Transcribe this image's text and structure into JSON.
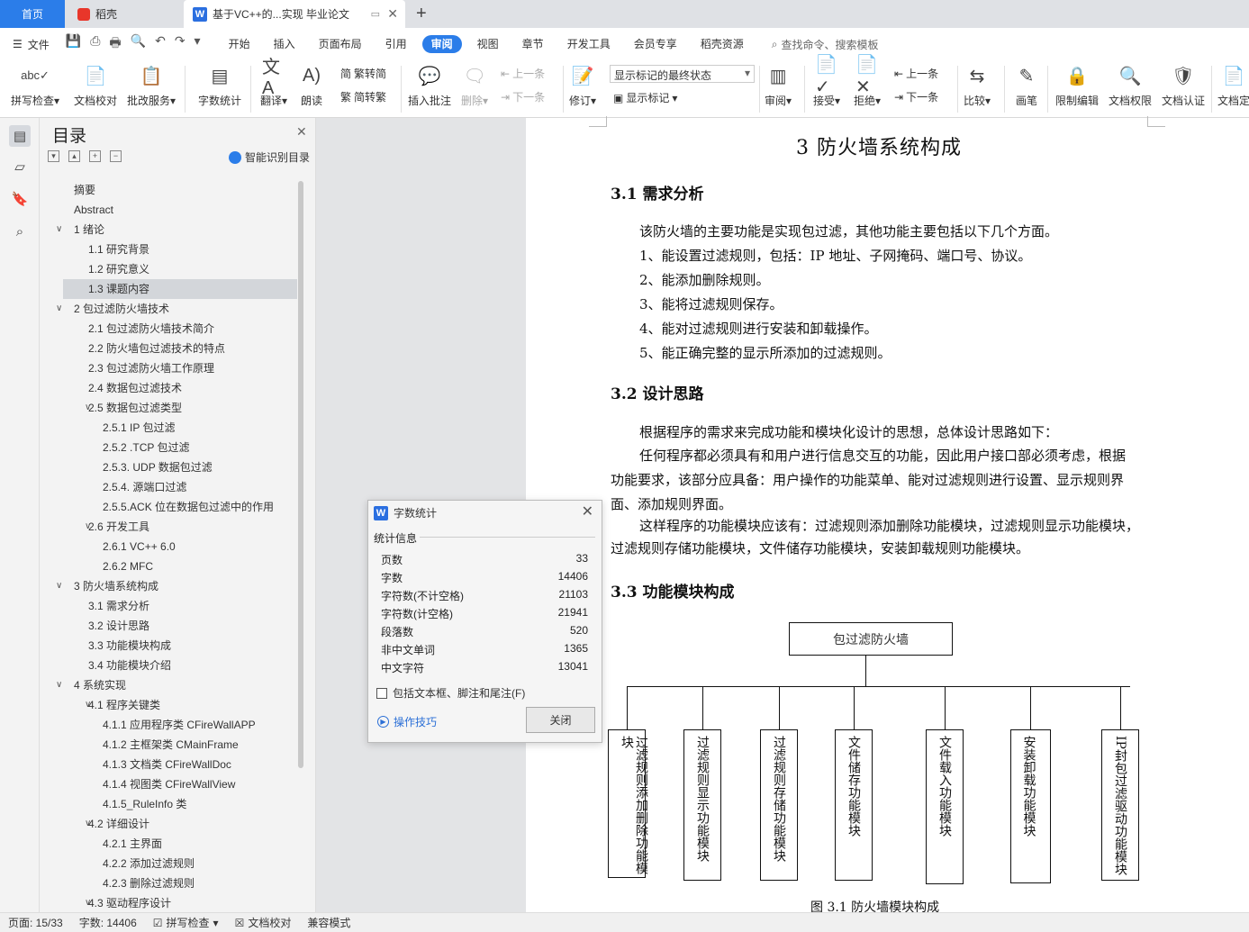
{
  "tabs": {
    "home": "首页",
    "doc": "稻壳",
    "active": "基于VC++的...实现 毕业论文"
  },
  "menu": {
    "file": "文件",
    "tabs": [
      "开始",
      "插入",
      "页面布局",
      "引用",
      "审阅",
      "视图",
      "章节",
      "开发工具",
      "会员专享",
      "稻壳资源"
    ],
    "active_tab": "审阅",
    "search": "查找命令、搜索模板"
  },
  "ribbon": {
    "spell": "拼写检查",
    "proof": "文档校对",
    "annotate_service": "批改服务",
    "wordcount": "字数统计",
    "translate": "翻译",
    "read": "朗读",
    "to_trad": "繁转简",
    "to_simp": "简转繁",
    "insert_comment": "插入批注",
    "delete": "删除",
    "prev": "上一条",
    "next": "下一条",
    "revise": "修订",
    "mark_state": "显示标记的最终状态",
    "show_mark": "显示标记",
    "review": "审阅",
    "accept": "接受",
    "reject": "拒绝",
    "prev2": "上一条",
    "next2": "下一条",
    "compare": "比较",
    "pen": "画笔",
    "restrict": "限制编辑",
    "rights": "文档权限",
    "auth": "文档认证",
    "finalize": "文档定"
  },
  "nav": {
    "title": "目录",
    "smart": "智能识别目录",
    "items": [
      {
        "text": "摘要",
        "level": 0
      },
      {
        "text": "Abstract",
        "level": 0
      },
      {
        "text": "1  绪论",
        "level": 1
      },
      {
        "text": "1.1  研究背景",
        "level": 2
      },
      {
        "text": "1.2  研究意义",
        "level": 2
      },
      {
        "text": "1.3  课题内容",
        "level": 2
      },
      {
        "text": "2  包过滤防火墙技术",
        "level": 1
      },
      {
        "text": "2.1  包过滤防火墙技术简介",
        "level": 2
      },
      {
        "text": "2.2  防火墙包过滤技术的特点",
        "level": 2
      },
      {
        "text": "2.3  包过滤防火墙工作原理",
        "level": 2
      },
      {
        "text": "2.4  数据包过滤技术",
        "level": 2
      },
      {
        "text": "2.5  数据包过滤类型",
        "level": 3
      },
      {
        "text": "2.5.1 IP 包过滤",
        "level": 4
      },
      {
        "text": "2.5.2 .TCP 包过滤",
        "level": 4
      },
      {
        "text": "2.5.3. UDP 数据包过滤",
        "level": 4
      },
      {
        "text": "2.5.4.  源端口过滤",
        "level": 4
      },
      {
        "text": "2.5.5.ACK 位在数据包过滤中的作用",
        "level": 4
      },
      {
        "text": "2.6 开发工具",
        "level": 3
      },
      {
        "text": "2.6.1 VC++ 6.0",
        "level": 4
      },
      {
        "text": "2.6.2 MFC",
        "level": 4
      },
      {
        "text": "3  防火墙系统构成",
        "level": 1
      },
      {
        "text": "3.1  需求分析",
        "level": 2
      },
      {
        "text": "3.2  设计思路",
        "level": 2
      },
      {
        "text": "3.3  功能模块构成",
        "level": 2
      },
      {
        "text": "3.4  功能模块介绍",
        "level": 2
      },
      {
        "text": "4  系统实现",
        "level": 1
      },
      {
        "text": "4.1 程序关键类",
        "level": 3
      },
      {
        "text": "4.1.1 应用程序类 CFireWallAPP",
        "level": 4
      },
      {
        "text": "4.1.2 主框架类 CMainFrame",
        "level": 4
      },
      {
        "text": "4.1.3 文档类 CFireWallDoc",
        "level": 4
      },
      {
        "text": "4.1.4 视图类 CFireWallView",
        "level": 4
      },
      {
        "text": "4.1.5_RuleInfo 类",
        "level": 4
      },
      {
        "text": "4.2 详细设计",
        "level": 3
      },
      {
        "text": "4.2.1 主界面",
        "level": 4
      },
      {
        "text": "4.2.2 添加过滤规则",
        "level": 4
      },
      {
        "text": "4.2.3 删除过滤规则",
        "level": 4
      },
      {
        "text": "4.3 驱动程序设计",
        "level": 3
      }
    ],
    "selected": "1.3  课题内容"
  },
  "doc": {
    "chapter": "3  防火墙系统构成",
    "s31": "3.1  需求分析",
    "s31_lines": [
      "该防火墙的主要功能是实现包过滤，其他功能主要包括以下几个方面。",
      "1、能设置过滤规则，包括：IP 地址、子网掩码、端口号、协议。",
      "2、能添加删除规则。",
      "3、能将过滤规则保存。",
      "4、能对过滤规则进行安装和卸载操作。",
      "5、能正确完整的显示所添加的过滤规则。"
    ],
    "s32": "3.2  设计思路",
    "s32_lines": [
      "根据程序的需求来完成功能和模块化设计的思想，总体设计思路如下：",
      "任何程序都必须具有和用户进行信息交互的功能，因此用户接口部必须考虑，根据",
      "功能要求，该部分应具备：用户操作的功能菜单、能对过滤规则进行设置、显示规则界",
      "面、添加规则界面。",
      "这样程序的功能模块应该有：过滤规则添加删除功能模块，过滤规则显示功能模块，",
      "过滤规则存储功能模块，文件储存功能模块，安装卸载规则功能模块。"
    ],
    "s33": "3.3  功能模块构成",
    "diagram_root": "包过滤防火墙",
    "diagram_modules": [
      "过滤规则添加删除功能模块",
      "过滤规则显示功能模块",
      "过滤规则存储功能模块",
      "文件储存功能模块",
      "文件载入功能模块",
      "安装卸载功能模块",
      "IP封包过滤驱动功能模块"
    ],
    "caption": "图 3.1  防火墙模块构成"
  },
  "dialog": {
    "title": "字数统计",
    "section": "统计信息",
    "rows": [
      {
        "label": "页数",
        "value": "33"
      },
      {
        "label": "字数",
        "value": "14406"
      },
      {
        "label": "字符数(不计空格)",
        "value": "21103"
      },
      {
        "label": "字符数(计空格)",
        "value": "21941"
      },
      {
        "label": "段落数",
        "value": "520"
      },
      {
        "label": "非中文单词",
        "value": "1365"
      },
      {
        "label": "中文字符",
        "value": "13041"
      }
    ],
    "include": "包括文本框、脚注和尾注(F)",
    "tips": "操作技巧",
    "close": "关闭"
  },
  "status": {
    "page": "页面: 15/33",
    "words": "字数: 14406",
    "spell": "拼写检查",
    "proof": "文档校对",
    "compat": "兼容模式"
  },
  "colors": {
    "accent": "#2b7de9",
    "dialog_bg": "#f5f5f5"
  }
}
